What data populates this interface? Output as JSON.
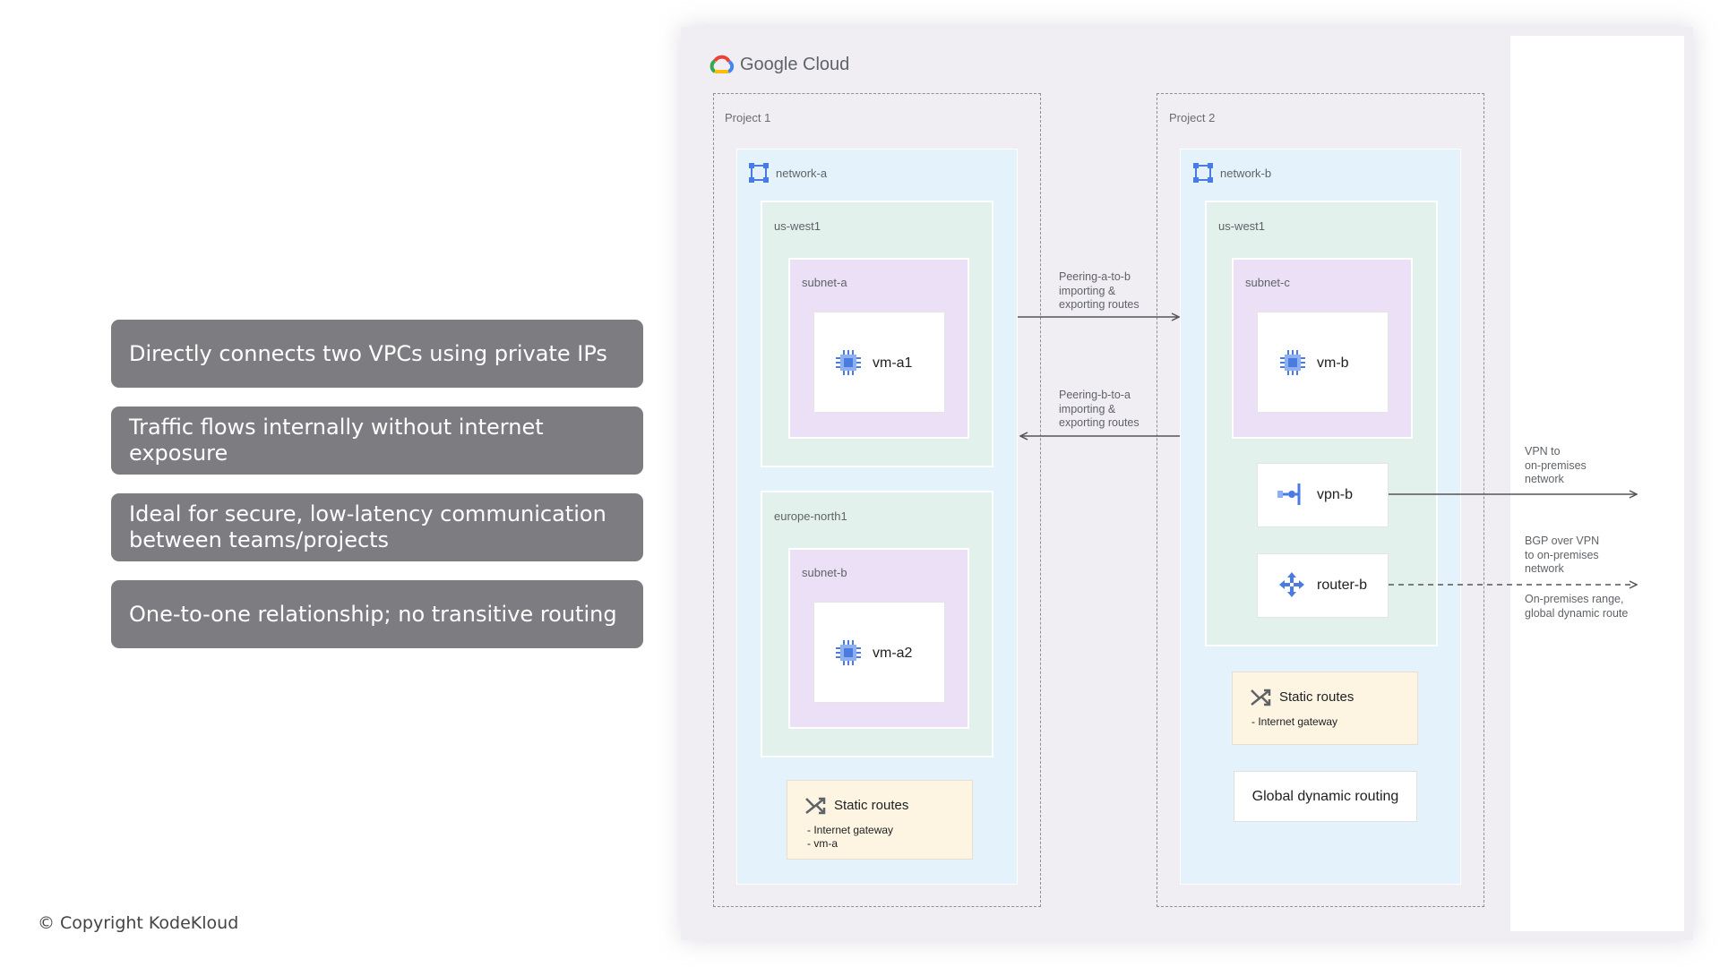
{
  "bullets": [
    "Directly connects two VPCs using private IPs",
    "Traffic flows internally without internet exposure",
    "Ideal for secure, low-latency communication between teams/projects",
    "One-to-one relationship; no transitive routing"
  ],
  "copyright": "© Copyright KodeKloud",
  "diagram": {
    "brand": "Google Cloud",
    "project1": {
      "label": "Project 1",
      "network": "network-a",
      "region1": {
        "label": "us-west1",
        "subnet": "subnet-a",
        "vm": "vm-a1"
      },
      "region2": {
        "label": "europe-north1",
        "subnet": "subnet-b",
        "vm": "vm-a2"
      },
      "static_routes": {
        "title": "Static routes",
        "line1": "- Internet gateway",
        "line2": "- vm-a"
      }
    },
    "project2": {
      "label": "Project 2",
      "network": "network-b",
      "region": {
        "label": "us-west1",
        "subnet": "subnet-c",
        "vm": "vm-b",
        "vpn": "vpn-b",
        "router": "router-b"
      },
      "static_routes": {
        "title": "Static routes",
        "line1": "- Internet gateway"
      },
      "global_routing": "Global dynamic routing"
    },
    "peering_a_to_b": "Peering-a-to-b\nimporting &\nexporting routes",
    "peering_b_to_a": "Peering-b-to-a\nimporting &\nexporting routes",
    "vpn_note": "VPN to\non-premises\nnetwork",
    "bgp_note": "BGP over VPN\nto on-premises\nnetwork",
    "onprem_note": "On-premises range,\nglobal dynamic route"
  },
  "colors": {
    "bullet_bg": "#7d7c80",
    "network_bg": "#e3f2fb",
    "region_bg": "#e3f1ec",
    "subnet_bg": "#ece0f6",
    "static_bg": "#fdf5e2",
    "icon_blue": "#4a7be0"
  },
  "icons": [
    "google-cloud-logo",
    "network-icon",
    "compute-chip-icon",
    "vpn-gateway-icon",
    "cloud-router-icon",
    "static-routes-icon"
  ]
}
